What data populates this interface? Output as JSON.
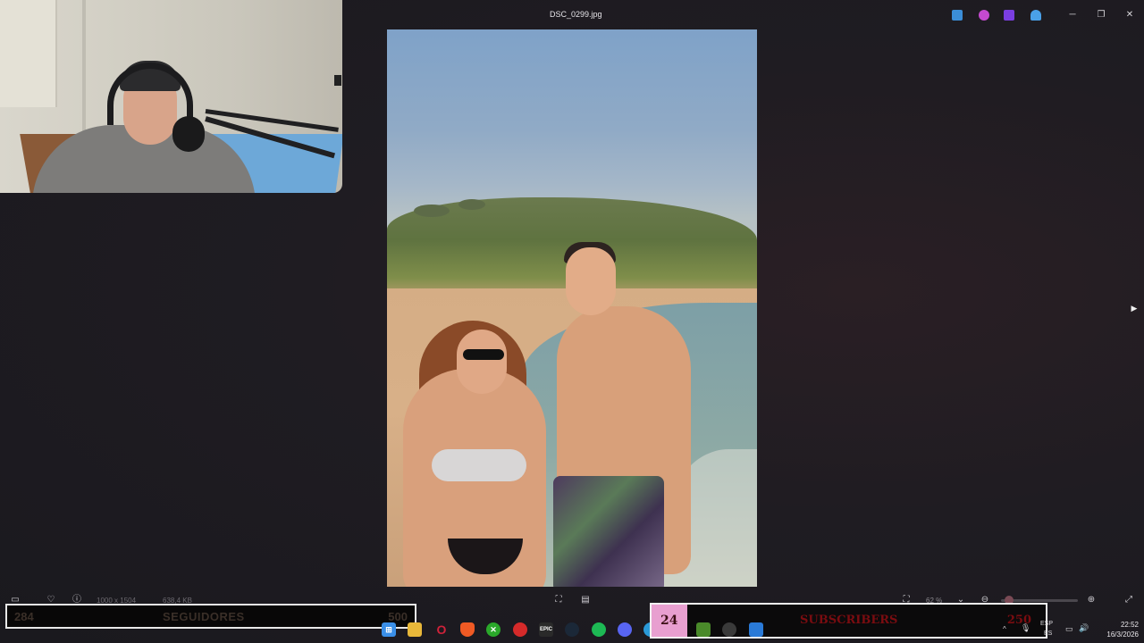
{
  "window": {
    "title": "DSC_0299.jpg",
    "controls": {
      "minimize": "─",
      "restore": "❐",
      "close": "✕"
    }
  },
  "titlebar_apps": [
    {
      "icon": "edit-icon",
      "color": "#3b8ed8"
    },
    {
      "icon": "copilot-icon",
      "color": "#c54ad0"
    },
    {
      "icon": "clipchamp-icon",
      "color": "#7a3ee0"
    },
    {
      "icon": "onedrive-icon",
      "color": "#4aa0e8"
    }
  ],
  "viewer": {
    "next_arrow": "▶",
    "toolbar": {
      "filmstrip": "▭",
      "favorite": "♡",
      "info": "ⓘ",
      "dimensions": "1000 x 1504",
      "filesize": "638,4 KB",
      "fit": "⛶",
      "adjust": "▤",
      "zoom_level": "62 %",
      "zoom_caret": "⌄",
      "zoom_out": "⊖",
      "zoom_in": "⊕",
      "fullscreen": "⤢",
      "zoom_fraction": 0.1
    }
  },
  "overlays": {
    "followers": {
      "count": "284",
      "label": "SEGUIDORES",
      "goal": "500"
    },
    "subscribers": {
      "count": "24",
      "label": "SUBSCRIBERS",
      "goal": "250"
    }
  },
  "taskbar": {
    "apps": [
      {
        "name": "start-icon",
        "glyph": "⊞",
        "color": "#3a8fe8"
      },
      {
        "name": "file-explorer-icon",
        "glyph": "▬",
        "color": "#e8b83a"
      },
      {
        "name": "opera-icon",
        "glyph": "O",
        "color": "#d0223a"
      },
      {
        "name": "brave-icon",
        "glyph": "◆",
        "color": "#f05a24"
      },
      {
        "name": "xbox-icon",
        "glyph": "✕",
        "color": "#2aa82a"
      },
      {
        "name": "app-red-icon",
        "glyph": "●",
        "color": "#d52a2a"
      },
      {
        "name": "epic-games-icon",
        "glyph": "EPIC",
        "color": "#2a2a2a"
      },
      {
        "name": "steam-icon",
        "glyph": "◎",
        "color": "#1b2838"
      },
      {
        "name": "spotify-icon",
        "glyph": "≋",
        "color": "#1db954"
      },
      {
        "name": "discord-icon",
        "glyph": "◉",
        "color": "#5865f2"
      },
      {
        "name": "minecraft-icon",
        "glyph": "▦",
        "color": "#4a8a2a"
      },
      {
        "name": "obs-icon",
        "glyph": "◍",
        "color": "#3a3a3a"
      },
      {
        "name": "photos-icon",
        "glyph": "▲",
        "color": "#2a7ad8"
      }
    ],
    "tray": {
      "chevron": "^",
      "mic": "🎙",
      "lang_top": "ESP",
      "lang_bottom": "ES",
      "network": "▭",
      "volume": "🔊",
      "time": "22:52",
      "date": "16/3/2026"
    }
  }
}
